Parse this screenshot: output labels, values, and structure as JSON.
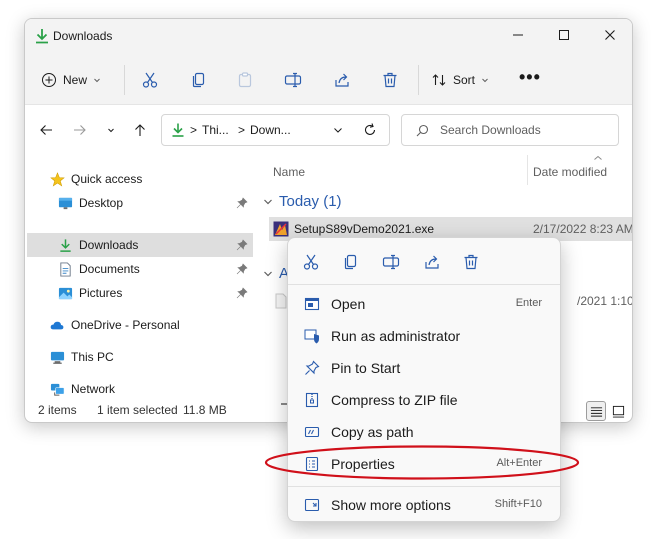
{
  "window": {
    "title": "Downloads"
  },
  "toolbar": {
    "new_label": "New",
    "sort_label": "Sort",
    "more_label": "•••"
  },
  "address": {
    "crumbs": [
      "Thi...",
      "Down..."
    ],
    "separator": ">"
  },
  "search": {
    "placeholder": "Search Downloads"
  },
  "sidebar": {
    "items": [
      {
        "label": "Quick access",
        "icon": "star-icon"
      },
      {
        "label": "Desktop",
        "icon": "desktop-icon",
        "pinned": true
      },
      {
        "label": "Downloads",
        "icon": "download-icon",
        "pinned": true,
        "selected": true
      },
      {
        "label": "Documents",
        "icon": "documents-icon",
        "pinned": true
      },
      {
        "label": "Pictures",
        "icon": "pictures-icon",
        "pinned": true
      },
      {
        "label": "OneDrive - Personal",
        "icon": "cloud-icon"
      },
      {
        "label": "This PC",
        "icon": "computer-icon"
      },
      {
        "label": "Network",
        "icon": "network-icon"
      }
    ]
  },
  "content": {
    "columns": [
      "Name",
      "Date modified"
    ],
    "groups": [
      {
        "label": "Today (1)"
      },
      {
        "label": "A"
      }
    ],
    "files": [
      {
        "name": "SetupS89vDemo2021.exe",
        "date": "2/17/2022 8:23 AM"
      },
      {
        "name": "",
        "date": "/2021 1:10 PM"
      }
    ]
  },
  "status": {
    "count": "2 items",
    "selection": "1 item selected",
    "size": "11.8 MB"
  },
  "context_menu": {
    "top_icons": [
      "cut-icon",
      "copy-icon",
      "rename-icon",
      "share-icon",
      "delete-icon"
    ],
    "items": [
      {
        "label": "Open",
        "shortcut": "Enter"
      },
      {
        "label": "Run as administrator",
        "shortcut": ""
      },
      {
        "label": "Pin to Start",
        "shortcut": ""
      },
      {
        "label": "Compress to ZIP file",
        "shortcut": ""
      },
      {
        "label": "Copy as path",
        "shortcut": ""
      },
      {
        "label": "Properties",
        "shortcut": "Alt+Enter"
      },
      {
        "label": "Show more options",
        "shortcut": "Shift+F10"
      }
    ]
  },
  "colors": {
    "accent": "#0067c0",
    "highlight_ellipse": "#d0101a",
    "download_green": "#2aa148",
    "folder_blue": "#2a5cad"
  }
}
